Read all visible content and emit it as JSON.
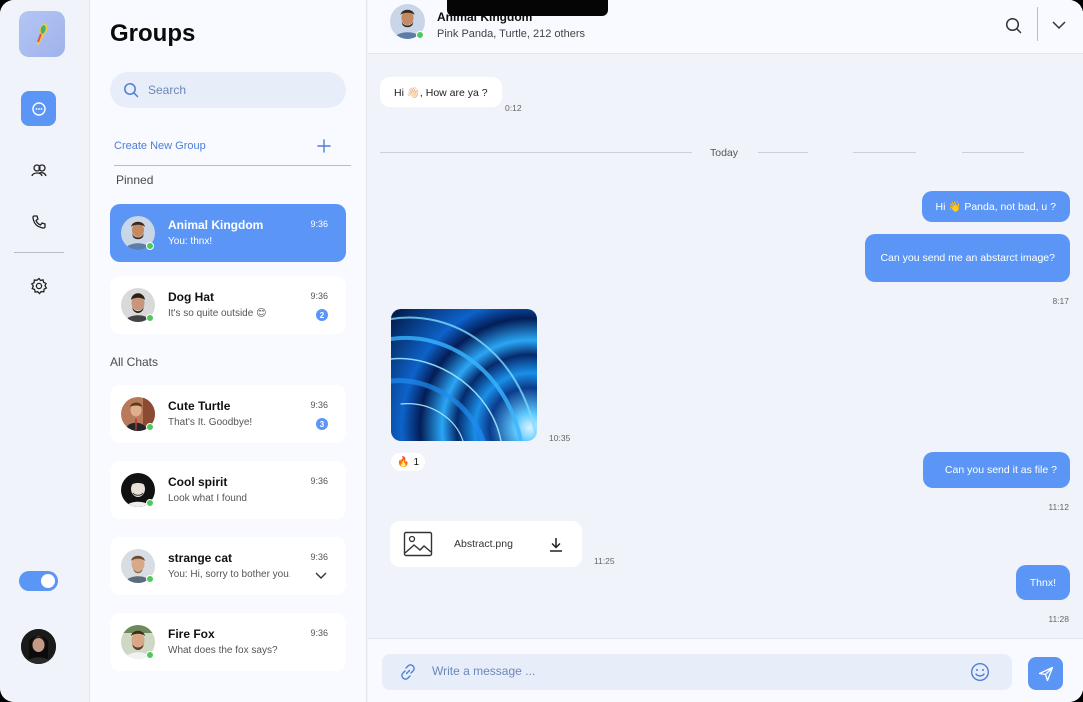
{
  "colors": {
    "accent": "#5b96f7",
    "online": "#4ec95d"
  },
  "sidebar": {
    "icons": [
      "logo-icon",
      "chat-icon",
      "users-icon",
      "phone-icon",
      "gear-icon"
    ],
    "theme_toggle": "on"
  },
  "list": {
    "title": "Groups",
    "search_placeholder": "Search",
    "create_label": "Create New Group",
    "pinned_label": "Pinned",
    "all_label": "All Chats",
    "pinned": [
      {
        "name": "Animal Kingdom",
        "msg": "You: thnx!",
        "time": "9:36",
        "active": true
      },
      {
        "name": "Dog Hat",
        "msg": "It's so quite outside 😊",
        "time": "9:36",
        "badge": "2"
      }
    ],
    "chats": [
      {
        "name": "Cute Turtle",
        "msg": "That's It. Goodbye!",
        "time": "9:36",
        "badge": "3"
      },
      {
        "name": "Cool spirit",
        "msg": "Look what I found",
        "time": "9:36"
      },
      {
        "name": "strange cat",
        "msg": "You: Hi, sorry to bother you...",
        "time": "9:36"
      },
      {
        "name": "Fire Fox",
        "msg": "What does the fox says?",
        "time": "9:36"
      }
    ]
  },
  "chat": {
    "title": "Animal Kingdom",
    "subtitle": "Pink Panda, Turtle, 212 others",
    "divider": "Today",
    "messages": [
      {
        "text": "Hi 👋🏻, How are ya ?",
        "time": "0:12"
      },
      {
        "text": "Hi 👋 Panda, not bad, u ?"
      },
      {
        "text": "Can you send me an abstarct image?",
        "time": "8:17"
      },
      {
        "time": "10:35"
      },
      {
        "text": "Can you send it as file ?",
        "time": "11:12"
      },
      {
        "text": "Abstract.png",
        "time": "11:25"
      },
      {
        "text": "Thnx!",
        "time": "11:28"
      }
    ],
    "reaction": {
      "emoji": "🔥",
      "count": "1"
    },
    "composer_placeholder": "Write a message ..."
  }
}
